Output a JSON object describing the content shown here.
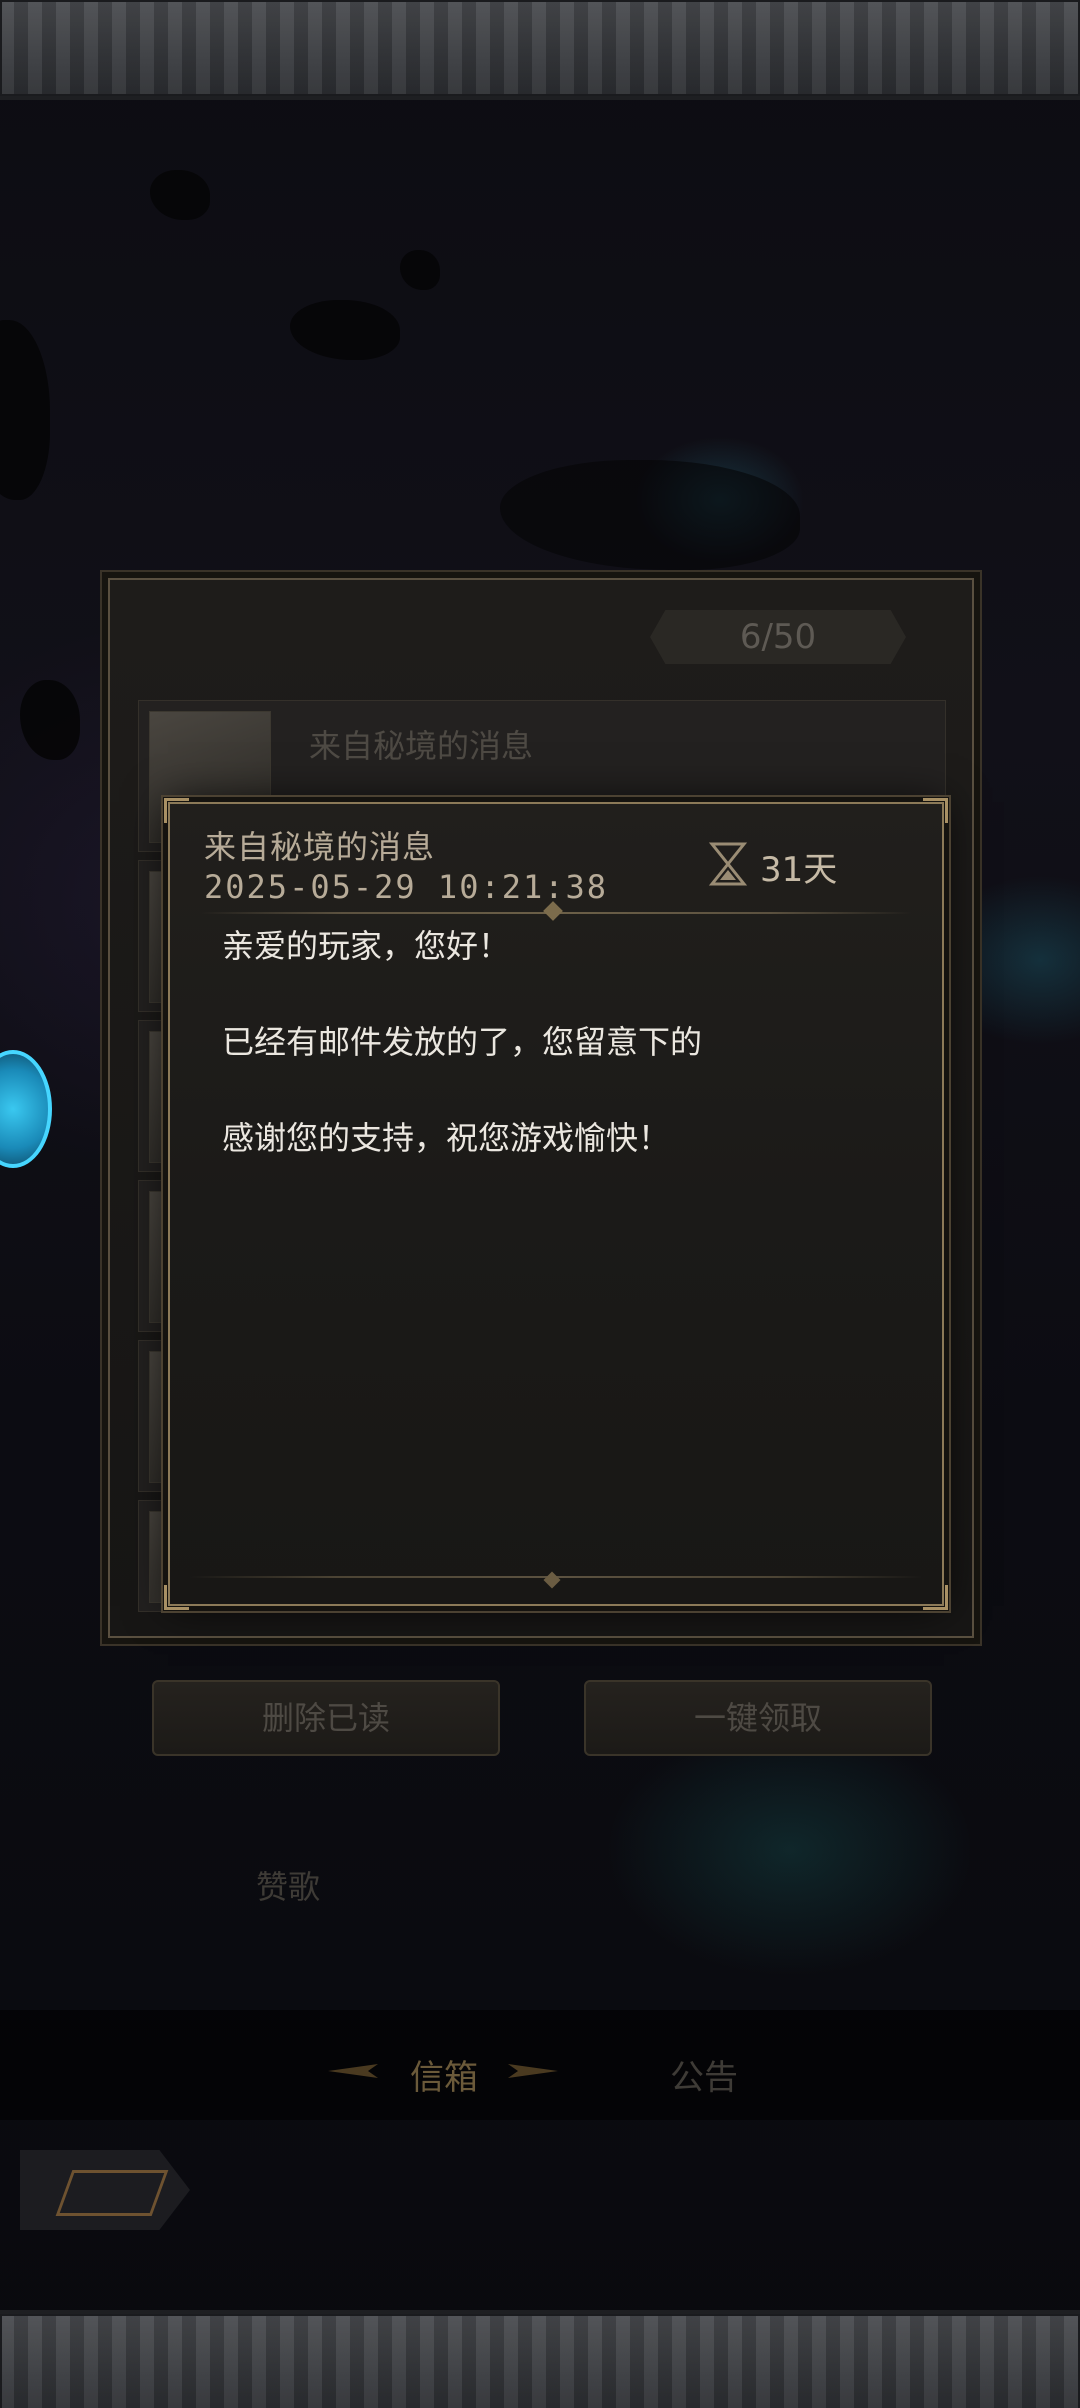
{
  "mail_list": {
    "count": "6/50",
    "first_row": {
      "title": "来自秘境的消息",
      "date": "2025-05-29 10:21:38",
      "days": "31天"
    }
  },
  "actions": {
    "delete_read": "删除已读",
    "claim_all": "一键领取"
  },
  "praise_label": "赞歌",
  "tabs": {
    "mailbox": "信箱",
    "notice": "公告"
  },
  "dialog": {
    "title": "来自秘境的消息",
    "date": "2025-05-29  10:21:38",
    "days_left": "31天",
    "body": {
      "greeting": "亲爱的玩家，您好！",
      "line1": "已经有邮件发放的了，您留意下的",
      "line2": "感谢您的支持，祝您游戏愉快！"
    }
  },
  "icons": [
    "hourglass-icon",
    "mail-scroll-icon",
    "back-arrow-icon"
  ],
  "colors": {
    "dialog_border": "#8c7a58",
    "dialog_text": "#ebe7e0",
    "header_text": "#b7ab98"
  }
}
